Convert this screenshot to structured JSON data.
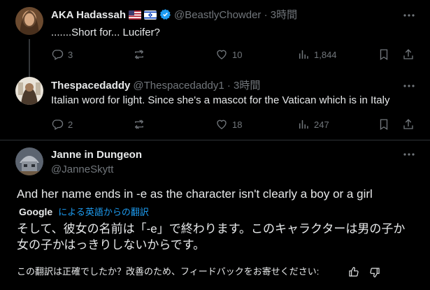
{
  "replies": [
    {
      "name": "AKA Hadassah",
      "handle": "@BeastlyChowder",
      "time": "3時間",
      "text": ".......Short for... Lucifer?",
      "flags": [
        "us-flag",
        "israel-flag"
      ],
      "verified": true,
      "stats": {
        "replies": "3",
        "reposts": "",
        "likes": "10",
        "views": "1,844"
      }
    },
    {
      "name": "Thespacedaddy",
      "handle": "@Thespacedaddy1",
      "time": "3時間",
      "text": "Italian word for light. Since she's a mascot for the Vatican which is in Italy",
      "flags": [],
      "verified": false,
      "stats": {
        "replies": "2",
        "reposts": "",
        "likes": "18",
        "views": "247"
      }
    }
  ],
  "main_post": {
    "name": "Janne in Dungeon",
    "handle": "@JanneSkytt",
    "text": "And her name ends in -e as the character isn't clearly a boy or a girl",
    "google_label": "Google",
    "translate_label": "による英語からの翻訳",
    "translation_line1": "そして、彼女の名前は「-e」で終わります。このキャラクターは男の子か",
    "translation_line2": "女の子かはっきりしないからです。",
    "feedback_prompt": "この翻訳は正確でしたか？改善のため、フィードバックをお寄せください:"
  },
  "colors": {
    "background": "#000000",
    "text": "#e7e9ea",
    "muted": "#71767b",
    "link": "#1d9bf0",
    "divider": "#2f3336"
  }
}
